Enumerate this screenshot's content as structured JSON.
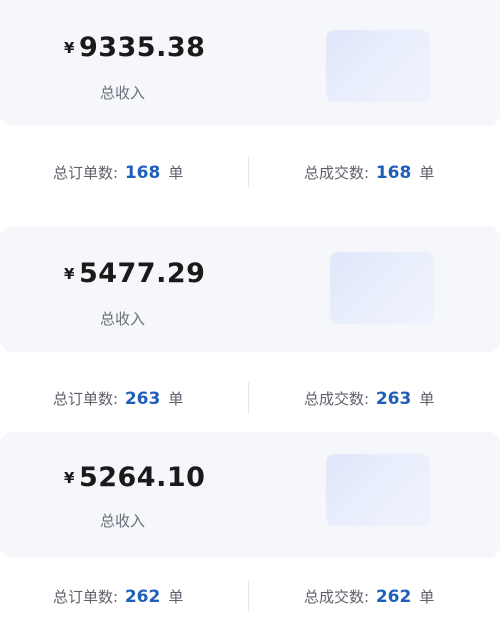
{
  "cards": [
    {
      "currency": "¥",
      "amount": "9335.38",
      "income_label": "总收入",
      "orders_label": "总订单数:",
      "orders_value": "168",
      "orders_unit": "单",
      "deals_label": "总成交数:",
      "deals_value": "168",
      "deals_unit": "单"
    },
    {
      "currency": "¥",
      "amount": "5477.29",
      "income_label": "总收入",
      "orders_label": "总订单数:",
      "orders_value": "263",
      "orders_unit": "单",
      "deals_label": "总成交数:",
      "deals_value": "263",
      "deals_unit": "单"
    },
    {
      "currency": "¥",
      "amount": "5264.10",
      "income_label": "总收入",
      "orders_label": "总订单数:",
      "orders_value": "262",
      "orders_unit": "单",
      "deals_label": "总成交数:",
      "deals_value": "262",
      "deals_unit": "单"
    }
  ],
  "colors": {
    "accent_number": "#1f5fb8",
    "card_background": "#f6f7fb",
    "label_gray": "#6b6f78"
  },
  "icons": {
    "thumbnail": "blurred-image-thumbnail"
  }
}
